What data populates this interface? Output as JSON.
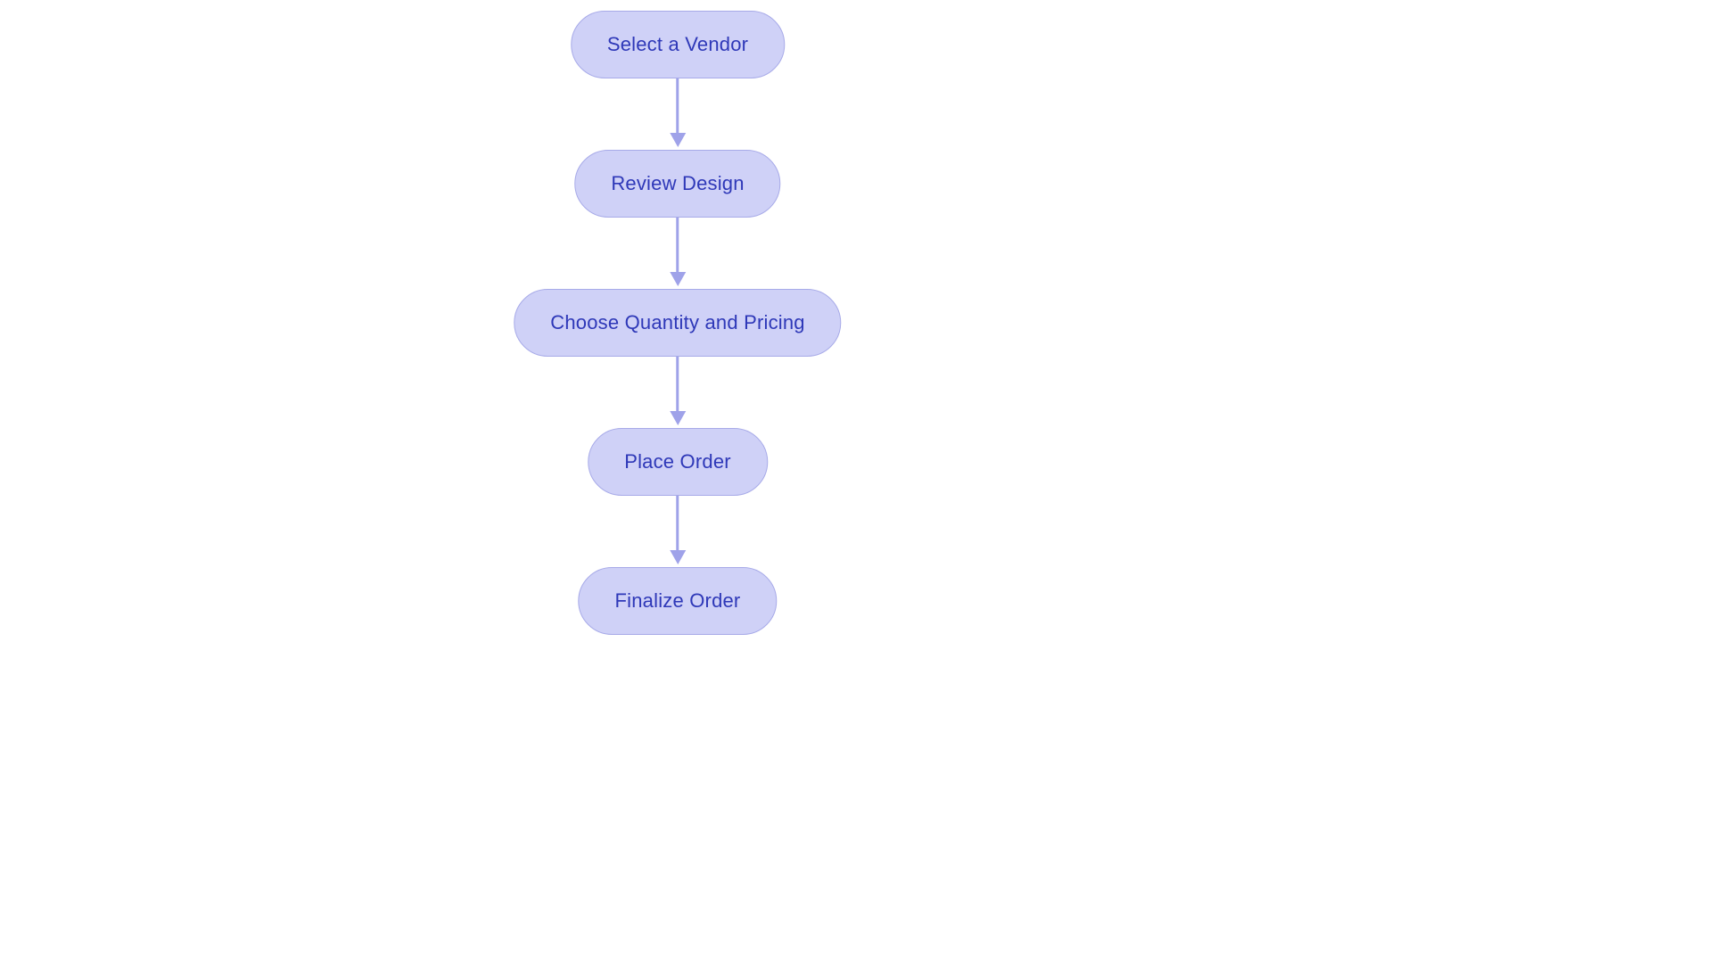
{
  "flowchart": {
    "nodes": [
      {
        "label": "Select a Vendor"
      },
      {
        "label": "Review Design"
      },
      {
        "label": "Choose Quantity and Pricing"
      },
      {
        "label": "Place Order"
      },
      {
        "label": "Finalize Order"
      }
    ]
  },
  "colors": {
    "node_fill": "#cfd1f7",
    "node_border": "#a7aae8",
    "node_text": "#2e38b8",
    "arrow": "#9fa2e9"
  }
}
